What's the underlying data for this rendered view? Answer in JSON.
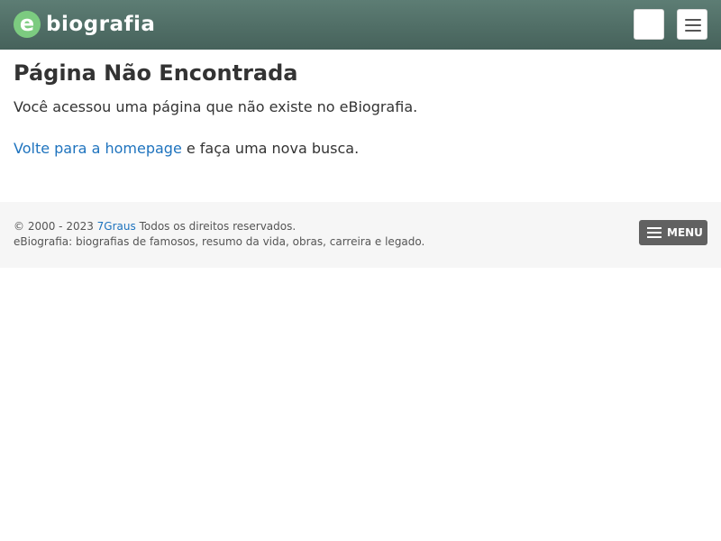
{
  "header": {
    "logo_letter": "e",
    "logo_text": "biografia",
    "search_icon": "search-icon",
    "menu_icon": "hamburger-icon"
  },
  "main": {
    "title": "Página Não Encontrada",
    "message": "Você acessou uma página que não existe no eBiografia.",
    "back_link": "Volte para a homepage",
    "back_suffix": " e faça uma nova busca."
  },
  "footer": {
    "copyright_prefix": "© 2000 - 2023 ",
    "company_link": "7Graus",
    "copyright_suffix": " Todos os direitos reservados.",
    "description": "eBiografia: biografias de famosos, resumo da vida, obras, carreira e legado.",
    "menu_label": "MENU"
  },
  "colors": {
    "header_bg": "#4f6d65",
    "logo_badge": "#7ccb80",
    "link": "#1e73be",
    "footer_bg": "#f6f6f6",
    "footer_button": "#616161"
  }
}
